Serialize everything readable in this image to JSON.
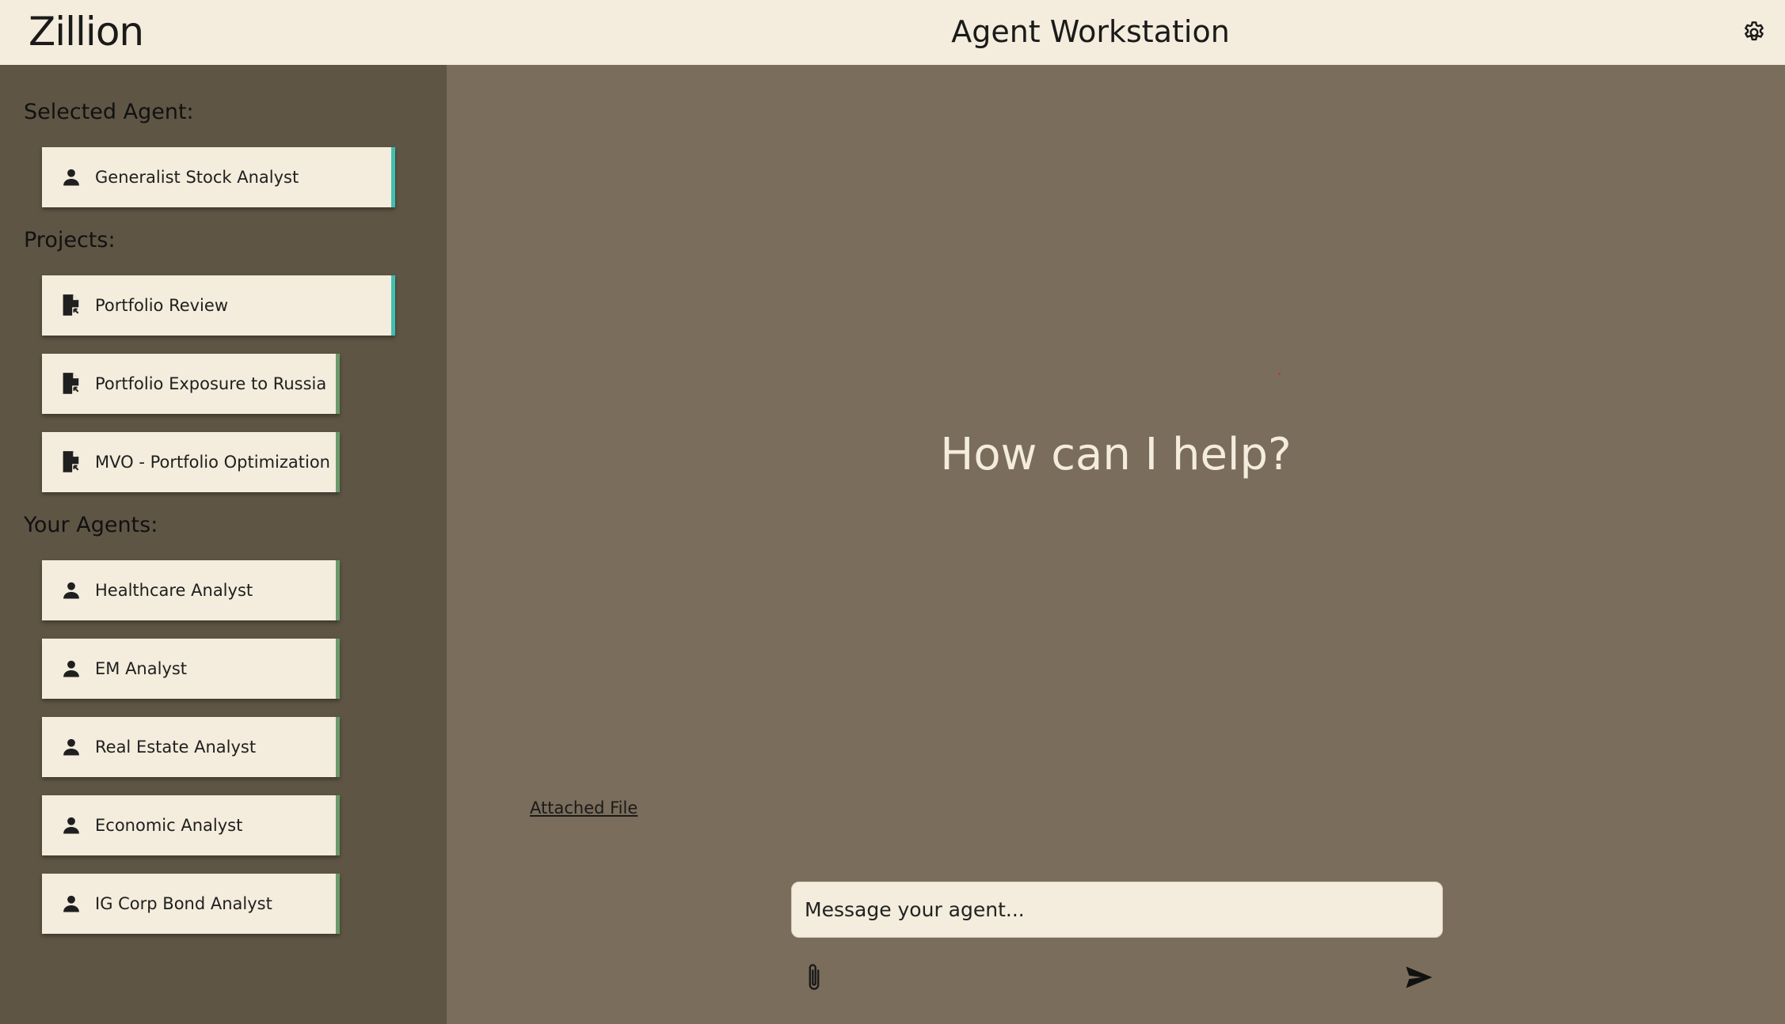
{
  "app": {
    "logo": "Zillion",
    "title": "Agent Workstation"
  },
  "sidebar": {
    "selected_agent_label": "Selected Agent:",
    "selected_agent": {
      "label": "Generalist Stock Analyst",
      "icon": "person-icon"
    },
    "projects_label": "Projects:",
    "projects": [
      {
        "label": "Portfolio Review",
        "icon": "file-shortcut-icon",
        "active": true
      },
      {
        "label": "Portfolio Exposure to Russia",
        "icon": "file-shortcut-icon",
        "active": false
      },
      {
        "label": "MVO - Portfolio Optimization",
        "icon": "file-shortcut-icon",
        "active": false
      }
    ],
    "agents_label": "Your Agents:",
    "agents": [
      {
        "label": "Healthcare Analyst",
        "icon": "person-icon"
      },
      {
        "label": "EM Analyst",
        "icon": "person-icon"
      },
      {
        "label": "Real Estate Analyst",
        "icon": "person-icon"
      },
      {
        "label": "Economic Analyst",
        "icon": "person-icon"
      },
      {
        "label": "IG Corp Bond Analyst",
        "icon": "person-icon"
      }
    ]
  },
  "main": {
    "prompt": "How can I help?",
    "attached_file_link": "Attached File",
    "message_placeholder": "Message your agent..."
  },
  "colors": {
    "header_bg": "#f4ecdc",
    "sidebar_bg": "#5f5545",
    "main_bg": "#7a6d5b",
    "card_bg": "#f4ecdc",
    "active_accent": "#3fbfb2",
    "inactive_accent": "#6b9a6a"
  }
}
